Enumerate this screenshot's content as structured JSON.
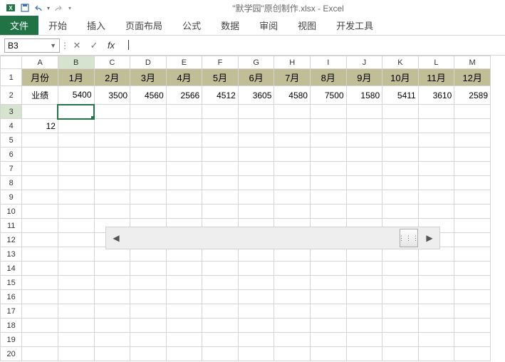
{
  "title": "\"默学园\"原创制作.xlsx - Excel",
  "qat": {
    "save": "save-icon",
    "undo": "undo-icon",
    "redo": "redo-icon"
  },
  "ribbon": {
    "file": "文件",
    "tabs": [
      "开始",
      "插入",
      "页面布局",
      "公式",
      "数据",
      "审阅",
      "视图",
      "开发工具"
    ]
  },
  "fxrow": {
    "namebox": "B3",
    "cancel": "✕",
    "confirm": "✓",
    "fx": "fx",
    "formula": ""
  },
  "columns": [
    "A",
    "B",
    "C",
    "D",
    "E",
    "F",
    "G",
    "H",
    "I",
    "J",
    "K",
    "L",
    "M"
  ],
  "rows_count": 20,
  "active_cell": {
    "row": 3,
    "col": "B"
  },
  "data": {
    "r1": {
      "A": "月份",
      "B": "1月",
      "C": "2月",
      "D": "3月",
      "E": "4月",
      "F": "5月",
      "G": "6月",
      "H": "7月",
      "I": "8月",
      "J": "9月",
      "K": "10月",
      "L": "11月",
      "M": "12月"
    },
    "r2": {
      "A": "业绩",
      "B": "5400",
      "C": "3500",
      "D": "4560",
      "E": "2566",
      "F": "4512",
      "G": "3605",
      "H": "4580",
      "I": "7500",
      "J": "1580",
      "K": "5411",
      "L": "3610",
      "M": "2589"
    },
    "r4": {
      "A": "12"
    }
  },
  "floatbar": {
    "left": "◀",
    "right": "▶",
    "thumb": "⋮⋮⋮"
  }
}
